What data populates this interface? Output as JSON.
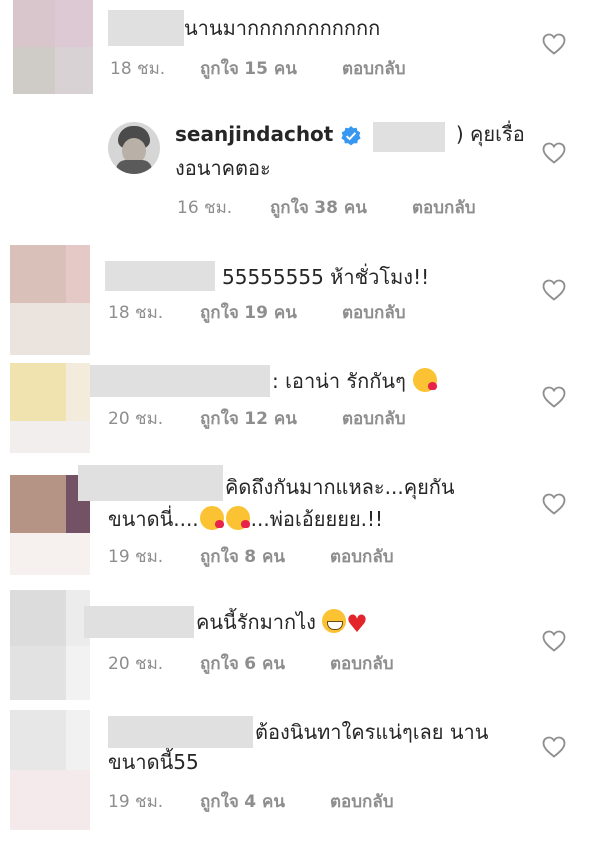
{
  "comments": [
    {
      "text": "นานมากกกกกกกกกกก",
      "time": "18 ชม.",
      "likes_prefix": "ถูกใจ",
      "likes": "15 คน",
      "reply": "ตอบกลับ"
    },
    {
      "username": "seanjindachot",
      "text_pre": "(",
      "text_post": ") คุยเรื่อ",
      "text_line2": "งอนาคตอะ",
      "time": "16 ชม.",
      "likes_prefix": "ถูกใจ",
      "likes": "38 คน",
      "reply": "ตอบกลับ"
    },
    {
      "text": "55555555 ห้าชั่วโมง!!",
      "time": "18 ชม.",
      "likes_prefix": "ถูกใจ",
      "likes": "19 คน",
      "reply": "ตอบกลับ"
    },
    {
      "text": ": เอาน่า รักกันๆ",
      "time": "20 ชม.",
      "likes_prefix": "ถูกใจ",
      "likes": "12 คน",
      "reply": "ตอบกลับ"
    },
    {
      "text": "คิดถึงกันมากแหละ...คุยกัน",
      "text_line2a": "ขนาดนี่....",
      "text_line2b": "...พ่อเอ้ยยยย.!!",
      "time": "19 ชม.",
      "likes_prefix": "ถูกใจ",
      "likes": "8 คน",
      "reply": "ตอบกลับ"
    },
    {
      "text": "คนนี้รักมากไง",
      "time": "20 ชม.",
      "likes_prefix": "ถูกใจ",
      "likes": "6 คน",
      "reply": "ตอบกลับ"
    },
    {
      "text": "ต้องนินทาใครแน่ๆเลย นาน",
      "text_line2": "ขนาดนี้55",
      "time": "19 ชม.",
      "likes_prefix": "ถูกใจ",
      "likes": "4 คน",
      "reply": "ตอบกลับ"
    }
  ],
  "icons": {
    "like": "heart-outline-icon",
    "verified": "verified-badge-icon"
  },
  "colors": {
    "meta": "#8e8e8e",
    "verified": "#3897f0",
    "redaction": "#e0e0e0"
  }
}
